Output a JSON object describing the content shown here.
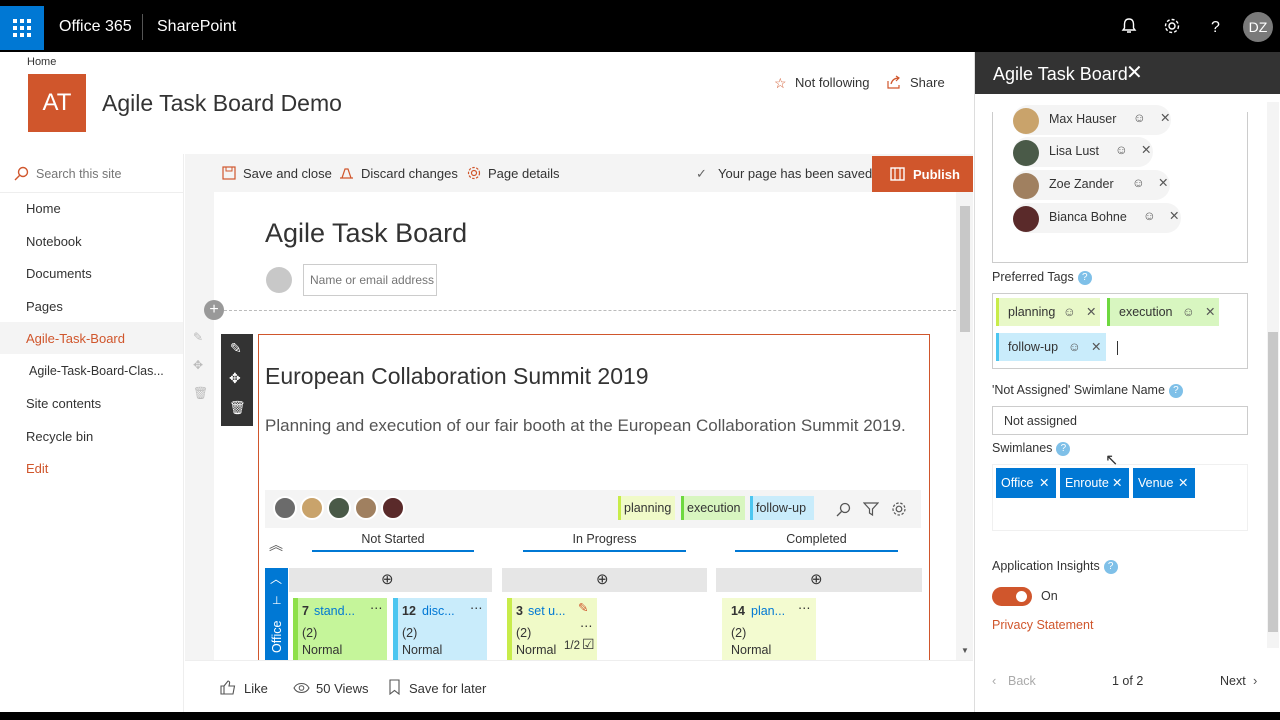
{
  "topbar": {
    "app": "Office 365",
    "product": "SharePoint",
    "user_initials": "DZ"
  },
  "site": {
    "breadcrumb": "Home",
    "logo": "AT",
    "title": "Agile Task Board Demo",
    "follow": "Not following",
    "share": "Share"
  },
  "search": {
    "placeholder": "Search this site"
  },
  "nav": [
    "Home",
    "Notebook",
    "Documents",
    "Pages",
    "Agile-Task-Board",
    "Agile-Task-Board-Clas...",
    "Site contents",
    "Recycle bin",
    "Edit"
  ],
  "cmdbar": {
    "save": "Save and close",
    "discard": "Discard changes",
    "details": "Page details",
    "saved": "Your page has been saved",
    "publish": "Publish"
  },
  "page": {
    "title": "Agile Task Board",
    "author_placeholder": "Name or email address",
    "board_title": "European Collaboration Summit 2019",
    "board_desc": "Planning and execution of our fair booth at the European Collaboration Summit 2019."
  },
  "board": {
    "tags": [
      "planning",
      "execution",
      "follow-up"
    ],
    "columns": [
      "Not Started",
      "In Progress",
      "Completed"
    ],
    "lane": "Office",
    "cards": [
      {
        "id": "7",
        "title": "stand...",
        "count": "(2)",
        "priority": "Normal",
        "color": "#c5f59a",
        "bar": "#8ee04a"
      },
      {
        "id": "12",
        "title": "disc...",
        "count": "(2)",
        "priority": "Normal",
        "color": "#c9ecfb",
        "bar": "#4cc6f0"
      },
      {
        "id": "3",
        "title": "set u...",
        "count": "(2)",
        "priority": "Normal",
        "color": "#f0fac8",
        "bar": "#c8ec4a",
        "progress": "1/2"
      },
      {
        "id": "14",
        "title": "plan...",
        "count": "(2)",
        "priority": "Normal",
        "color": "#f3fbd0",
        "bar": "#f3fbd0"
      }
    ]
  },
  "footer": {
    "like": "Like",
    "views": "50 Views",
    "save_later": "Save for later"
  },
  "panel": {
    "title": "Agile Task Board",
    "people": [
      "Max Hauser",
      "Lisa Lust",
      "Zoe Zander",
      "Bianca Bohne"
    ],
    "tags_label": "Preferred Tags",
    "tags": [
      {
        "name": "planning",
        "color": "#e8f8c8",
        "bar": "#c8ec4a"
      },
      {
        "name": "execution",
        "color": "#d8f6c0",
        "bar": "#6ed840"
      },
      {
        "name": "follow-up",
        "color": "#c9ecfb",
        "bar": "#4cc6f0"
      }
    ],
    "na_label": "'Not Assigned' Swimlane Name",
    "na_value": "Not assigned",
    "swimlanes_label": "Swimlanes",
    "swimlanes": [
      "Office",
      "Enroute",
      "Venue"
    ],
    "insights_label": "Application Insights",
    "insights_state": "On",
    "privacy": "Privacy Statement",
    "back": "Back",
    "pager": "1 of 2",
    "next": "Next"
  },
  "colors": {
    "accent": "#d0562c",
    "blue": "#0078d4"
  }
}
